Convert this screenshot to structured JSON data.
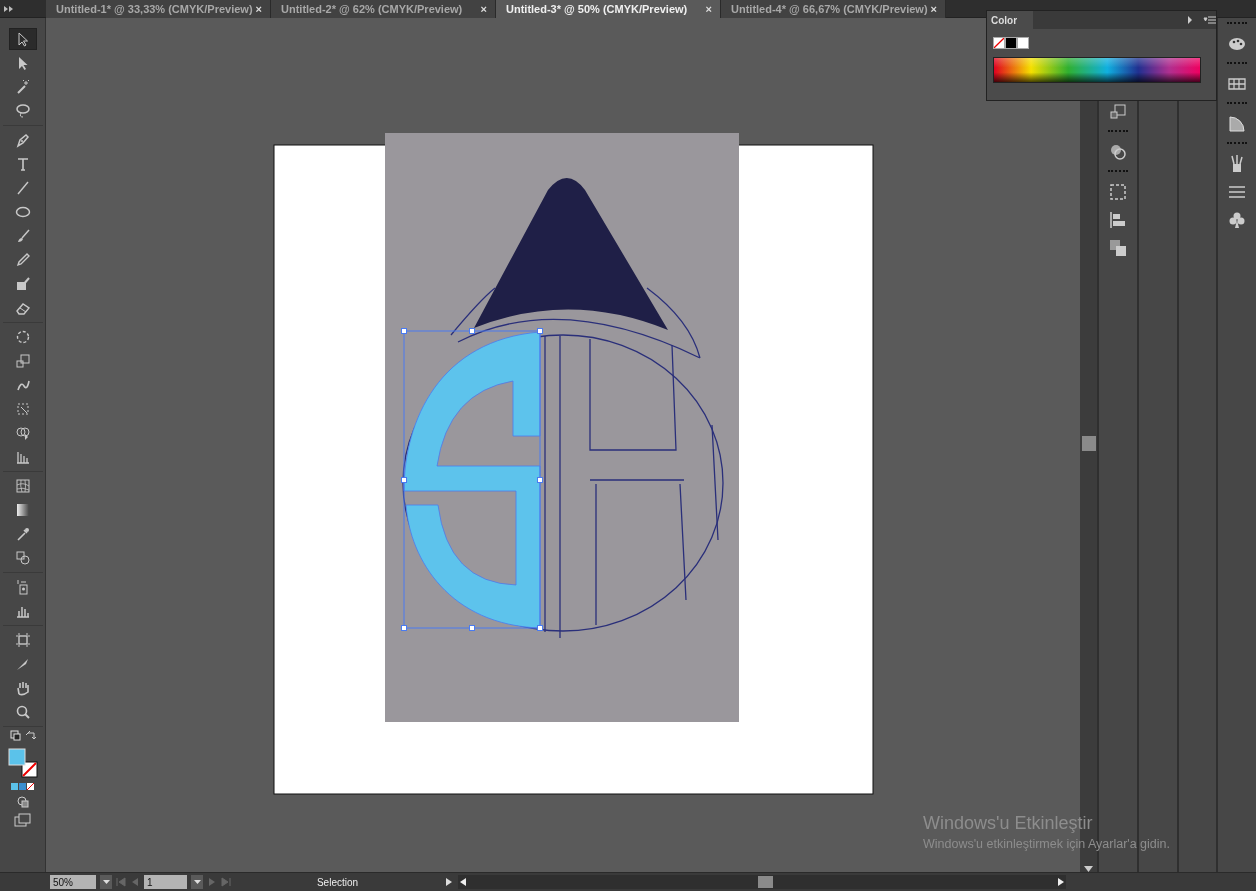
{
  "tabs": [
    {
      "label": "Untitled-1* @ 33,33% (CMYK/Preview)",
      "close": "×",
      "selected": false
    },
    {
      "label": "Untitled-2* @ 62% (CMYK/Preview)",
      "close": "×",
      "selected": false
    },
    {
      "label": "Untitled-3* @ 50% (CMYK/Preview)",
      "close": "×",
      "selected": true
    },
    {
      "label": "Untitled-4* @ 66,67% (CMYK/Preview)",
      "close": "×",
      "selected": false
    }
  ],
  "tools": [
    {
      "kind": "selection",
      "selected": true
    },
    {
      "kind": "direct",
      "selected": false
    },
    {
      "kind": "wand",
      "selected": false
    },
    {
      "kind": "lasso",
      "selected": false
    },
    {
      "kind": "pen",
      "selected": false
    },
    {
      "kind": "type",
      "selected": false
    },
    {
      "kind": "line",
      "selected": false
    },
    {
      "kind": "ellipse",
      "selected": false
    },
    {
      "kind": "brush",
      "selected": false
    },
    {
      "kind": "pencil",
      "selected": false
    },
    {
      "kind": "blob",
      "selected": false
    },
    {
      "kind": "eraser",
      "selected": false
    },
    {
      "kind": "rotate",
      "selected": false
    },
    {
      "kind": "scale",
      "selected": false
    },
    {
      "kind": "warp",
      "selected": false
    },
    {
      "kind": "transform",
      "selected": false
    },
    {
      "kind": "builder",
      "selected": false
    },
    {
      "kind": "graph3d",
      "selected": false
    },
    {
      "kind": "mesh",
      "selected": false
    },
    {
      "kind": "gradient",
      "selected": false
    },
    {
      "kind": "eyedropper",
      "selected": false
    },
    {
      "kind": "blend",
      "selected": false
    },
    {
      "kind": "sprayer",
      "selected": false
    },
    {
      "kind": "chart",
      "selected": false
    },
    {
      "kind": "artboard",
      "selected": false
    },
    {
      "kind": "slice",
      "selected": false
    },
    {
      "kind": "hand",
      "selected": false
    },
    {
      "kind": "zoom",
      "selected": false
    }
  ],
  "color_panel": {
    "title": "Color"
  },
  "status_bar": {
    "zoom": "50%",
    "artboard": "1",
    "current_tool": "Selection"
  },
  "activation_notice": {
    "title": "Windows'u Etkinleştir",
    "message": "Windows'u etkinleştirmek için Ayarlar'a gidin."
  }
}
